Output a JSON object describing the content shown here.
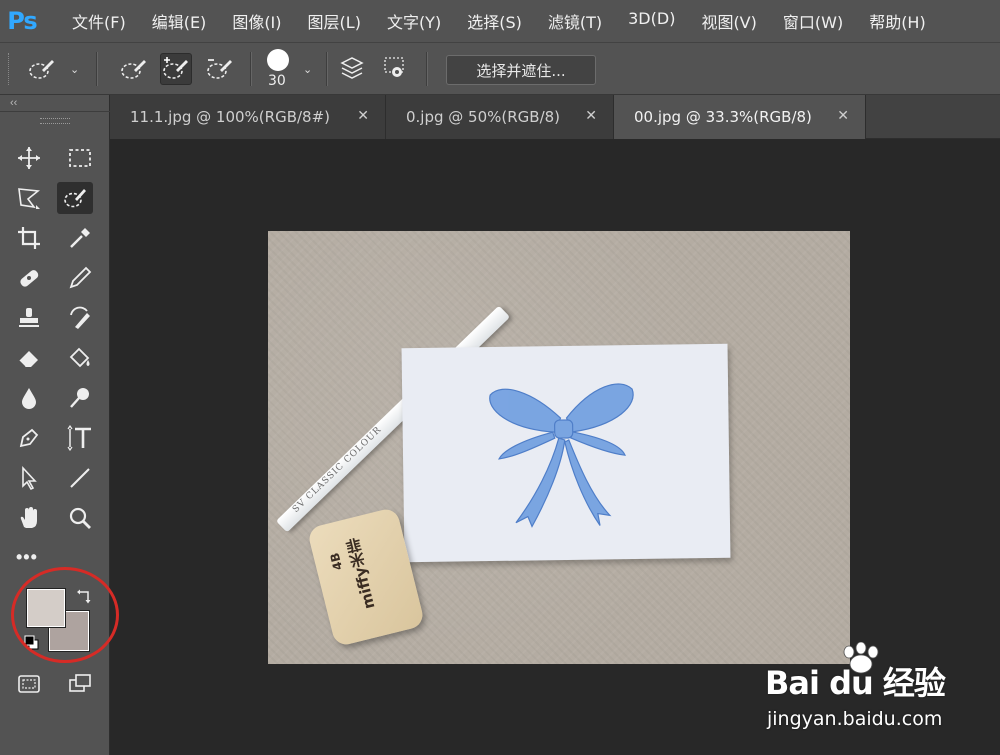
{
  "app": {
    "logo": "Ps"
  },
  "menu": [
    "文件(F)",
    "编辑(E)",
    "图像(I)",
    "图层(L)",
    "文字(Y)",
    "选择(S)",
    "滤镜(T)",
    "3D(D)",
    "视图(V)",
    "窗口(W)",
    "帮助(H)"
  ],
  "options": {
    "brush_size": "30",
    "select_and_mask": "选择并遮住..."
  },
  "toolbar": {
    "collapse": "‹‹",
    "more": "•••",
    "foreground_color": "#d4cdc8",
    "background_color": "#aea39f"
  },
  "tabs": [
    {
      "label": "11.1.jpg @ 100%(RGB/8#)",
      "active": false
    },
    {
      "label": "0.jpg @ 50%(RGB/8)",
      "active": false
    },
    {
      "label": "00.jpg @ 33.3%(RGB/8)",
      "active": true
    }
  ],
  "document": {
    "pencil_text": "SV CLASSIC COLOUR",
    "eraser_text": "miffy米菲",
    "eraser_grade": "4B"
  },
  "watermark": {
    "brand": "Bai du 经验",
    "url": "jingyan.baidu.com"
  },
  "colors": {
    "accent": "#31a8ff",
    "highlight_circle": "#d62b26",
    "bow": "#5b8fd6"
  }
}
